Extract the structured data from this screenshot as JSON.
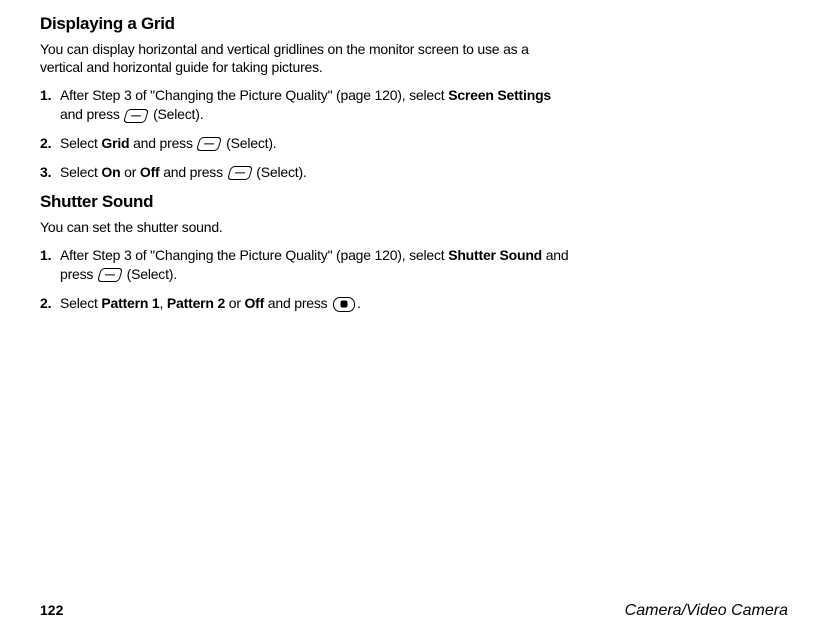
{
  "section1": {
    "heading": "Displaying a Grid",
    "intro": "You can display horizontal and vertical gridlines on the monitor screen to use as a vertical and horizontal guide for taking pictures.",
    "step1": {
      "num": "1.",
      "pre": "After Step 3 of \"Changing the Picture Quality\" (page 120), select ",
      "bold1": "Screen Settings",
      "mid1": " and press ",
      "post": " (Select)."
    },
    "step2": {
      "num": "2.",
      "pre": "Select ",
      "bold1": "Grid",
      "mid1": " and press ",
      "post": " (Select)."
    },
    "step3": {
      "num": "3.",
      "pre": "Select ",
      "bold1": "On",
      "mid1": " or ",
      "bold2": "Off",
      "mid2": " and press ",
      "post": " (Select)."
    }
  },
  "section2": {
    "heading": "Shutter Sound",
    "intro": "You can set the shutter sound.",
    "step1": {
      "num": "1.",
      "pre": "After Step 3 of \"Changing the Picture Quality\" (page 120), select ",
      "bold1": "Shutter Sound",
      "mid1": " and press ",
      "post": " (Select)."
    },
    "step2": {
      "num": "2.",
      "pre": "Select ",
      "bold1": "Pattern 1",
      "mid1": ", ",
      "bold2": "Pattern 2",
      "mid2": " or ",
      "bold3": "Off",
      "mid3": " and press ",
      "post": "."
    }
  },
  "footer": {
    "page": "122",
    "section": "Camera/Video Camera"
  }
}
